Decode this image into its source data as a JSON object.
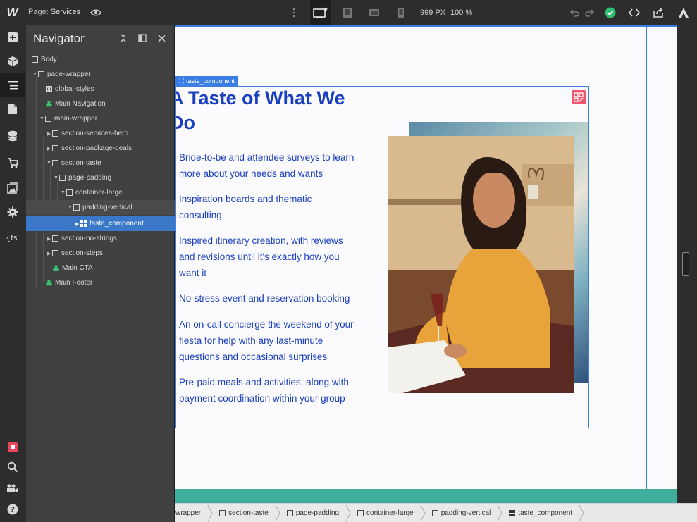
{
  "topbar": {
    "logo": "W",
    "page_prefix": "Page:",
    "page_name": "Services",
    "width_readout": "999 PX",
    "zoom_readout": "100 %"
  },
  "navigator": {
    "title": "Navigator",
    "tree": [
      {
        "label": "Body",
        "icon": "box-icon"
      },
      {
        "label": "page-wrapper",
        "icon": "box-icon"
      },
      {
        "label": "global-styles",
        "icon": "embed-icon"
      },
      {
        "label": "Main Navigation",
        "icon": "symbol-icon"
      },
      {
        "label": "main-wrapper",
        "icon": "box-icon"
      },
      {
        "label": "section-services-hero",
        "icon": "box-icon"
      },
      {
        "label": "section-package-deals",
        "icon": "box-icon"
      },
      {
        "label": "section-taste",
        "icon": "box-icon"
      },
      {
        "label": "page-padding",
        "icon": "box-icon"
      },
      {
        "label": "container-large",
        "icon": "box-icon"
      },
      {
        "label": "padding-vertical",
        "icon": "box-icon"
      },
      {
        "label": "taste_component",
        "icon": "grid-icon"
      },
      {
        "label": "section-no-strings",
        "icon": "box-icon"
      },
      {
        "label": "section-steps",
        "icon": "box-icon"
      },
      {
        "label": "Main CTA",
        "icon": "symbol-icon"
      },
      {
        "label": "Main Footer",
        "icon": "symbol-icon"
      }
    ]
  },
  "canvas": {
    "selected_tag": "taste_component",
    "heading_line1": "A Taste of What We",
    "heading_line2": "Do",
    "items": [
      {
        "line1": "Bride-to-be and attendee surveys to learn",
        "line2": "more about your needs and wants",
        "line3": ""
      },
      {
        "line1": "Inspiration boards and thematic",
        "line2": "consulting",
        "line3": ""
      },
      {
        "line1": "Inspired itinerary creation, with reviews",
        "line2": "and revisions until it's exactly how you",
        "line3": "want it"
      },
      {
        "line1": "No-stress event and reservation booking",
        "line2": "",
        "line3": ""
      },
      {
        "line1": "An on-call concierge the weekend of your",
        "line2": "fiesta for help with any last-minute",
        "line3": "questions and occasional surprises"
      },
      {
        "line1": "Pre-paid meals and activities, along with",
        "line2": "payment coordination within your group",
        "line3": ""
      }
    ],
    "accent_color": "#1a3fbf",
    "selection_color": "#3a7ee4"
  },
  "breadcrumb": [
    {
      "label": "wrapper",
      "icon": ""
    },
    {
      "label": "section-taste",
      "icon": "box-icon"
    },
    {
      "label": "page-padding",
      "icon": "box-icon"
    },
    {
      "label": "container-large",
      "icon": "box-icon"
    },
    {
      "label": "padding-vertical",
      "icon": "box-icon"
    },
    {
      "label": "taste_component",
      "icon": "grid-icon"
    }
  ]
}
